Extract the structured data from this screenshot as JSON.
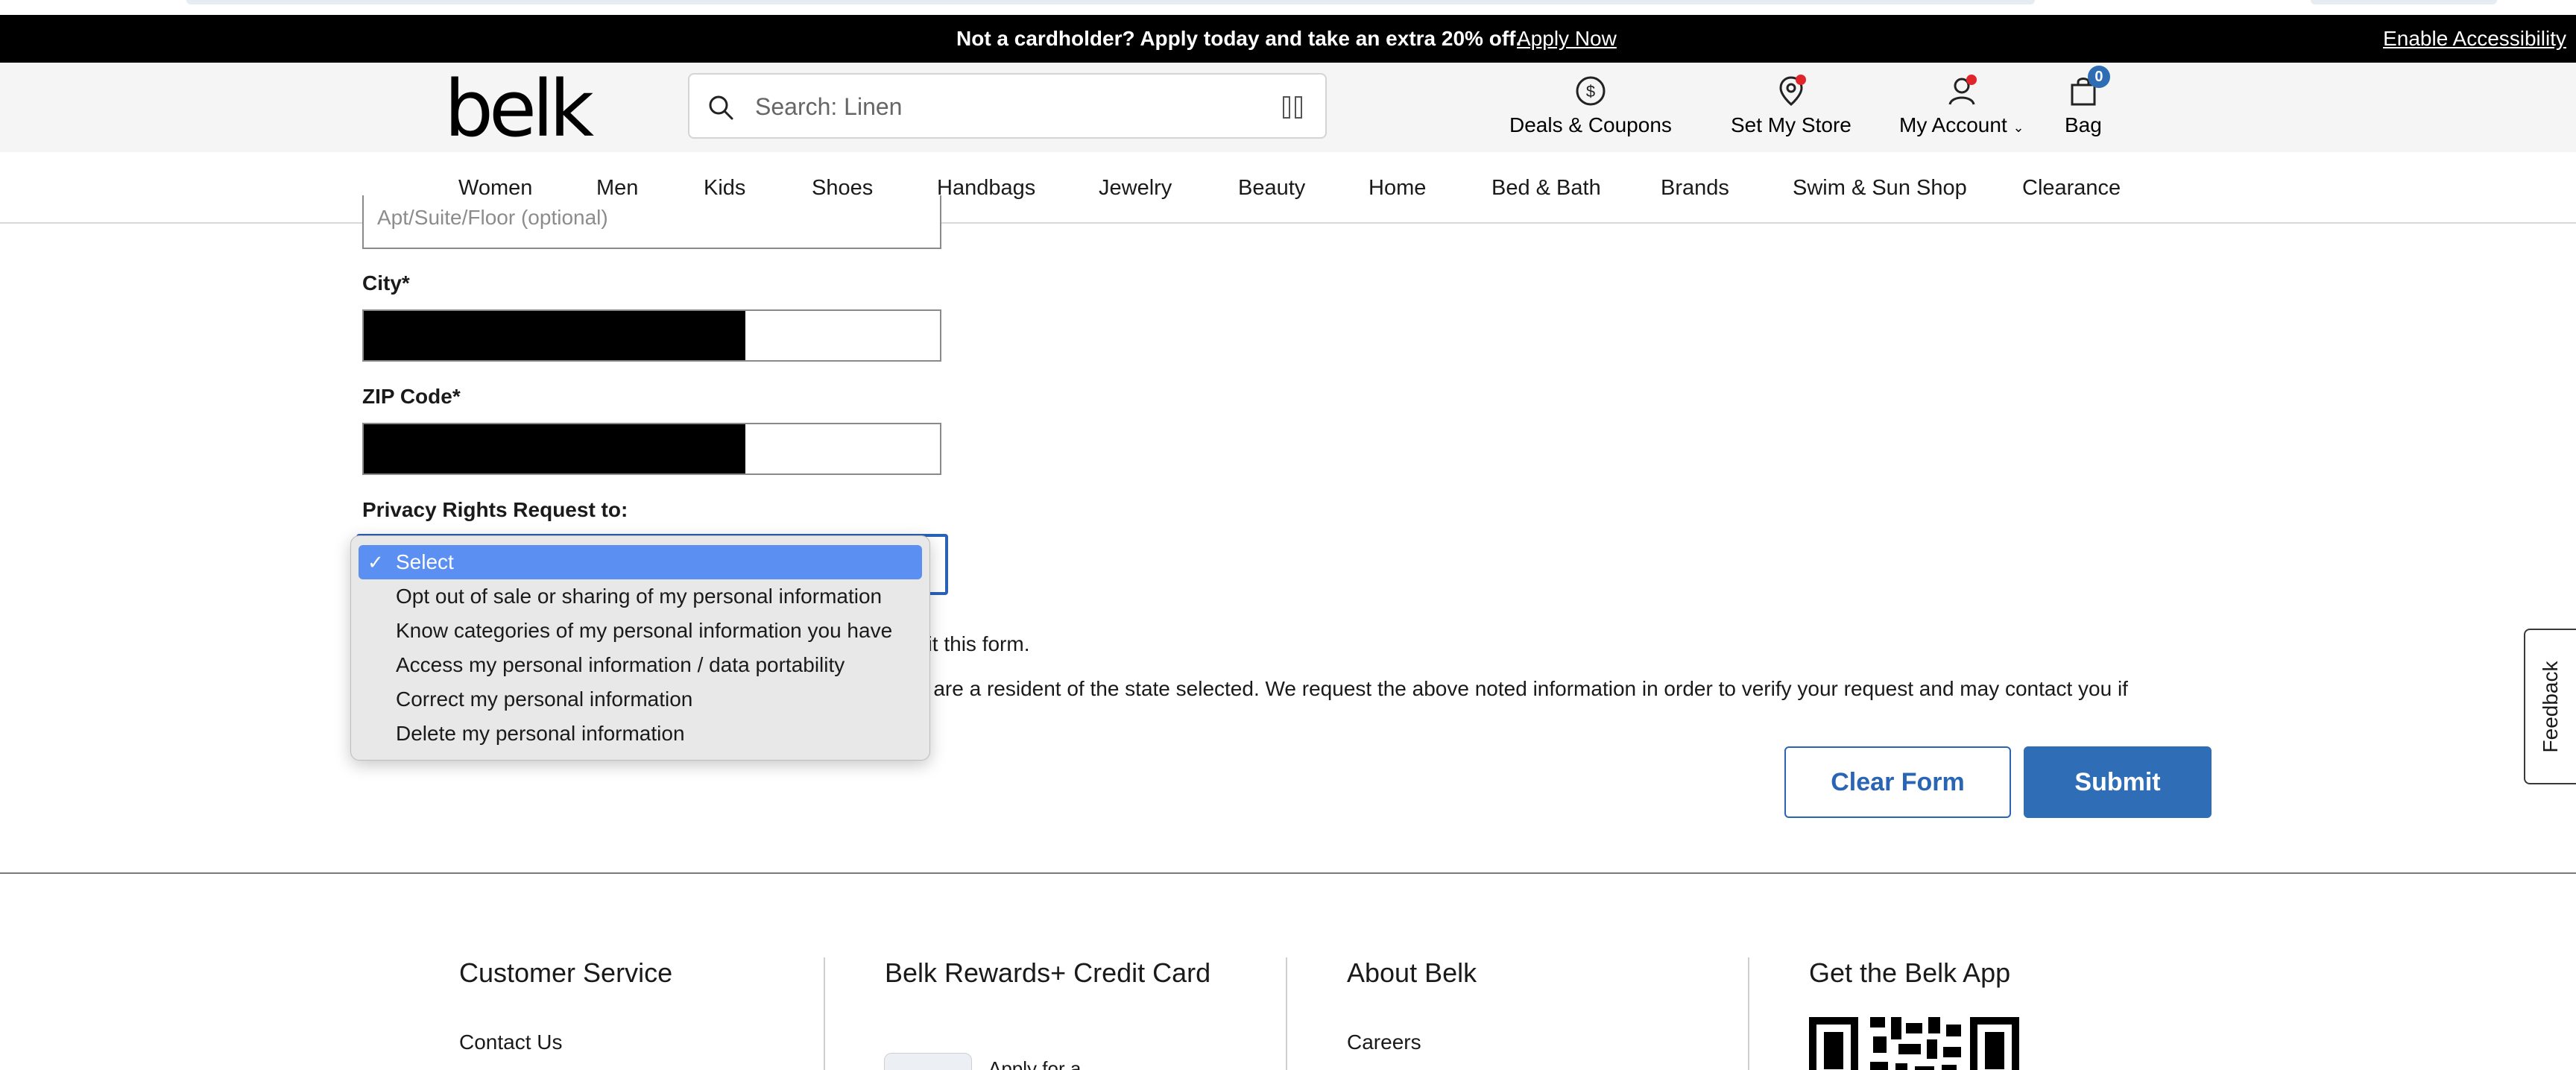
{
  "promo": {
    "text": "Not a cardholder? Apply today and take an extra 20% off.",
    "link": "Apply Now",
    "accessibility": "Enable Accessibility"
  },
  "header": {
    "logo": "belk",
    "search_placeholder": "Search: Linen",
    "utilities": [
      {
        "label": "Deals & Coupons",
        "icon": "dollar-circle-icon"
      },
      {
        "label": "Set My Store",
        "icon": "store-pin-icon"
      },
      {
        "label": "My Account",
        "icon": "account-icon"
      },
      {
        "label": "Bag",
        "icon": "bag-icon",
        "count": "0"
      }
    ]
  },
  "nav": [
    "Women",
    "Men",
    "Kids",
    "Shoes",
    "Handbags",
    "Jewelry",
    "Beauty",
    "Home",
    "Bed & Bath",
    "Brands",
    "Swim & Sun Shop",
    "Clearance"
  ],
  "form": {
    "apt_placeholder": "Apt/Suite/Floor (optional)",
    "city_label": "City*",
    "zip_label": "ZIP Code*",
    "privacy_label": "Privacy Rights Request to:",
    "dropdown_options": [
      "Select",
      "Opt out of sale or sharing of my personal information",
      "Know categories of my personal information you have",
      "Access my personal information / data portability",
      "Correct my personal information",
      "Delete my personal information"
    ],
    "selected_option": "Select",
    "partial_line_1": "nit this form.",
    "partial_line_2": "u are a resident of the state selected. We request the above noted information in order to verify your request and may contact you if",
    "clear_button": "Clear Form",
    "submit_button": "Submit"
  },
  "feedback": "Feedback",
  "footer": {
    "columns": [
      {
        "title": "Customer Service",
        "link": "Contact Us"
      },
      {
        "title": "Belk Rewards+ Credit Card",
        "link": "Apply for a"
      },
      {
        "title": "About Belk",
        "link": "Careers"
      },
      {
        "title": "Get the Belk App"
      }
    ]
  },
  "colors": {
    "accent_blue": "#2f6db7",
    "dropdown_highlight": "#5b8ff2",
    "alert_dot": "#e0262b"
  }
}
